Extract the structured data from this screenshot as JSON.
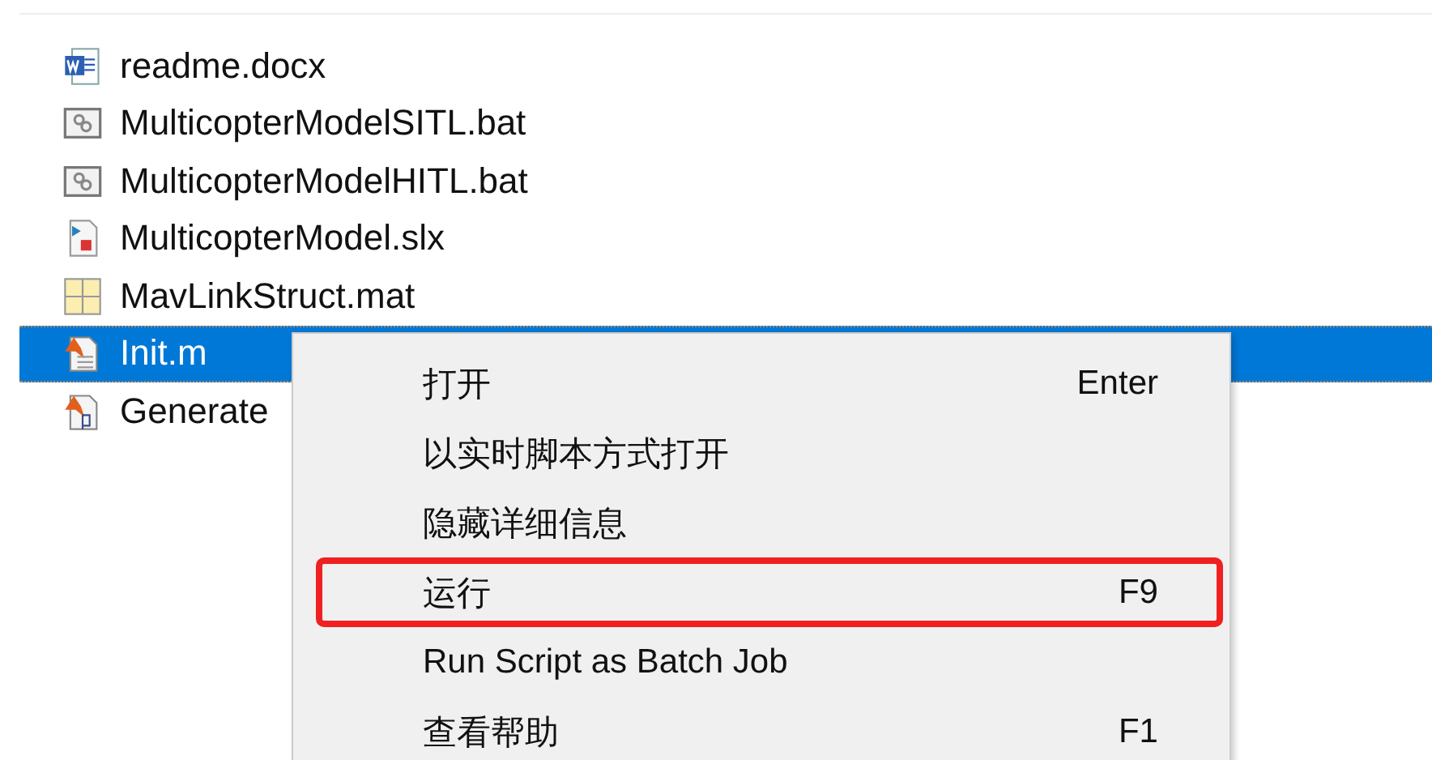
{
  "files": [
    {
      "name": "readme.docx",
      "kind": "word",
      "selected": false
    },
    {
      "name": "MulticopterModelSITL.bat",
      "kind": "bat",
      "selected": false
    },
    {
      "name": "MulticopterModelHITL.bat",
      "kind": "bat",
      "selected": false
    },
    {
      "name": "MulticopterModel.slx",
      "kind": "model",
      "selected": false
    },
    {
      "name": "MavLinkStruct.mat",
      "kind": "mat",
      "selected": false
    },
    {
      "name": "Init.m",
      "kind": "script",
      "selected": true
    },
    {
      "name": "Generate",
      "kind": "pcode",
      "selected": false
    }
  ],
  "context_menu": {
    "items": [
      {
        "label": "打开",
        "shortcut": "Enter",
        "highlighted": false
      },
      {
        "label": "以实时脚本方式打开",
        "highlighted": false
      },
      {
        "label": "隐藏详细信息",
        "highlighted": false
      },
      {
        "label": "运行",
        "shortcut": "F9",
        "highlighted": true
      },
      {
        "label": "Run Script as Batch Job",
        "highlighted": false
      },
      {
        "label": "查看帮助",
        "shortcut": "F1",
        "highlighted": false
      }
    ]
  }
}
